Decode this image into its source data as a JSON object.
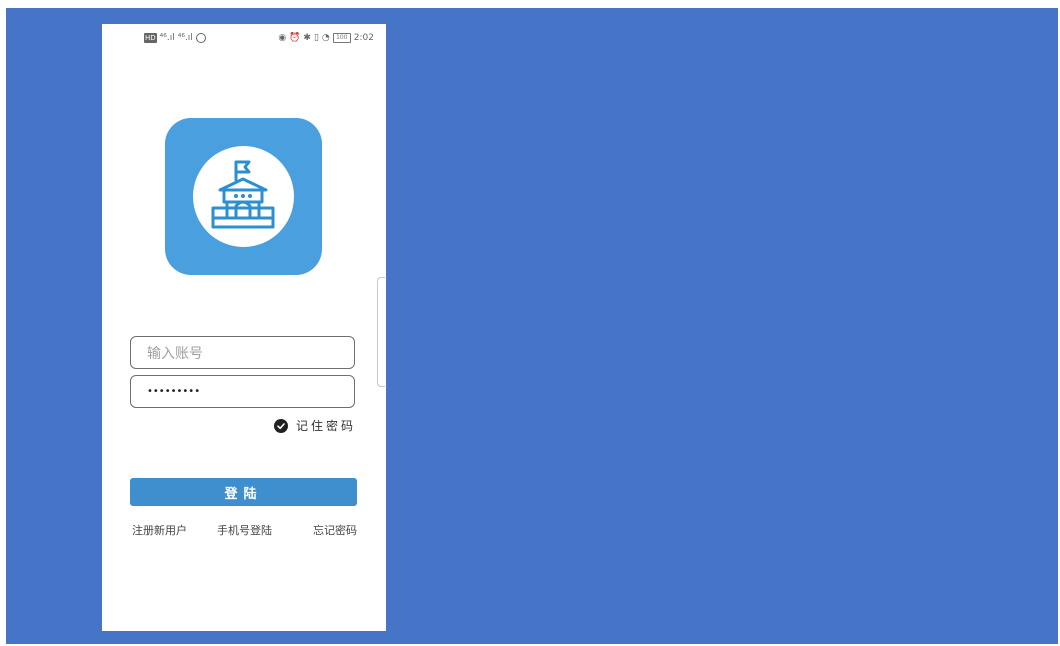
{
  "status_bar": {
    "carrier_badge": "HD",
    "signal1": "⁴⁶.ıl",
    "signal2": "⁴⁶.ıl",
    "battery_level": "100",
    "time": "2:02"
  },
  "login": {
    "account_placeholder": "输入账号",
    "password_value": "•••••••••",
    "remember_label": "记住密码",
    "login_button": "登陆"
  },
  "links": {
    "register": "注册新用户",
    "phone_login": "手机号登陆",
    "forgot_password": "忘记密码"
  },
  "colors": {
    "background": "#4674c6",
    "app_icon": "#4a9fdf",
    "button": "#3f8fce"
  }
}
